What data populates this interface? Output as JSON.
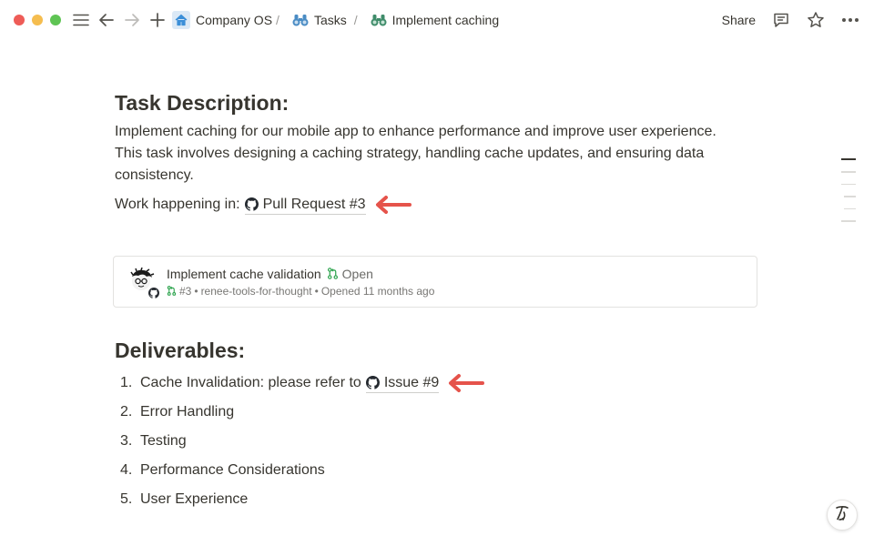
{
  "breadcrumbs": {
    "workspace": "Company OS",
    "parent": "Tasks",
    "current": "Implement caching",
    "separator": "/"
  },
  "topbar": {
    "share_label": "Share"
  },
  "colors": {
    "accent_arrow": "#e5534b",
    "pr_open_green": "#2da44e",
    "home_icon_blue": "#3b8fd8",
    "task_icon_green": "#3f8c6a",
    "traffic_red": "#ee5c57",
    "traffic_yellow": "#f5bd4f",
    "traffic_green": "#5fc454"
  },
  "task": {
    "heading": "Task Description:",
    "description_line1": "Implement caching for our mobile app to enhance performance and improve user experience.",
    "description_line2": "This task involves designing a caching strategy, handling cache updates, and ensuring data",
    "description_line3": "consistency.",
    "work_prefix": "Work happening in:",
    "pr_link_label": "Pull Request #3"
  },
  "pr_card": {
    "title": "Implement cache validation",
    "status": "Open",
    "number": "#3",
    "repo": "renee-tools-for-thought",
    "opened": "Opened 11 months ago",
    "meta_sep": "•"
  },
  "deliverables": {
    "heading": "Deliverables:",
    "items": [
      {
        "num": "1.",
        "text": "Cache Invalidation: please refer to",
        "link": "Issue #9"
      },
      {
        "num": "2.",
        "text": "Error Handling"
      },
      {
        "num": "3.",
        "text": "Testing"
      },
      {
        "num": "4.",
        "text": "Performance Considerations"
      },
      {
        "num": "5.",
        "text": "User Experience"
      }
    ]
  },
  "icons": {
    "menu": "hamburger-icon",
    "back": "arrow-left-icon",
    "forward": "arrow-right-icon",
    "new": "plus-icon",
    "home": "home-icon",
    "tasks": "binoculars-icon",
    "comment": "comment-icon",
    "favorite": "star-icon",
    "more": "ellipsis-icon",
    "github": "github-icon",
    "pr": "pull-request-icon",
    "help": "help-icon"
  }
}
